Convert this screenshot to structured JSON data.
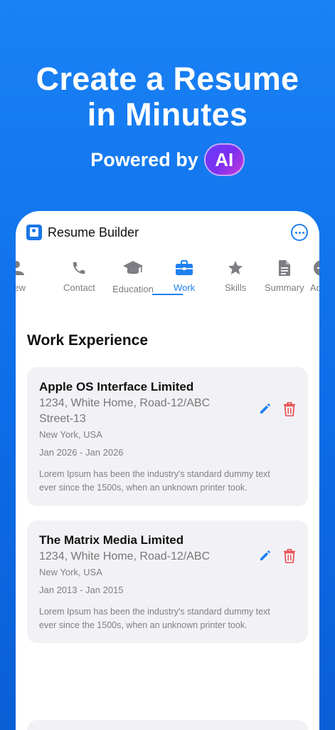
{
  "hero": {
    "title_line1": "Create a Resume",
    "title_line2": "in Minutes",
    "subtitle": "Powered by",
    "badge": "AI"
  },
  "app": {
    "title": "Resume Builder",
    "logo_icon": "resume-book-icon",
    "more_icon": "more-options-icon",
    "accent": "#1f80f0"
  },
  "tabs": [
    {
      "label": "view",
      "icon": "person-icon"
    },
    {
      "label": "Contact",
      "icon": "phone-icon"
    },
    {
      "label": "Education",
      "icon": "graduation-cap-icon"
    },
    {
      "label": "Work",
      "icon": "briefcase-icon",
      "active": true
    },
    {
      "label": "Skills",
      "icon": "star-icon"
    },
    {
      "label": "Summary",
      "icon": "document-icon"
    },
    {
      "label": "Additi",
      "icon": "plus-circle-icon"
    }
  ],
  "section": {
    "title": "Work Experience"
  },
  "experiences": [
    {
      "company": "Apple OS Interface Limited",
      "address": "1234, White Home, Road-12/ABC Street-13",
      "location": "New York, USA",
      "dates": "Jan 2026 - Jan 2026",
      "description": "Lorem Ipsum has been the industry's standard dummy text ever since the 1500s, when an unknown printer took."
    },
    {
      "company": "The Matrix Media Limited",
      "address": "1234, White Home, Road-12/ABC",
      "location": "New York, USA",
      "dates": "Jan 2013 - Jan 2015",
      "description": "Lorem Ipsum has been the industry's standard dummy text ever since the 1500s, when an unknown printer took."
    }
  ],
  "colors": {
    "edit": "#1f80f0",
    "delete": "#e8484a",
    "background": "#1478ee"
  }
}
